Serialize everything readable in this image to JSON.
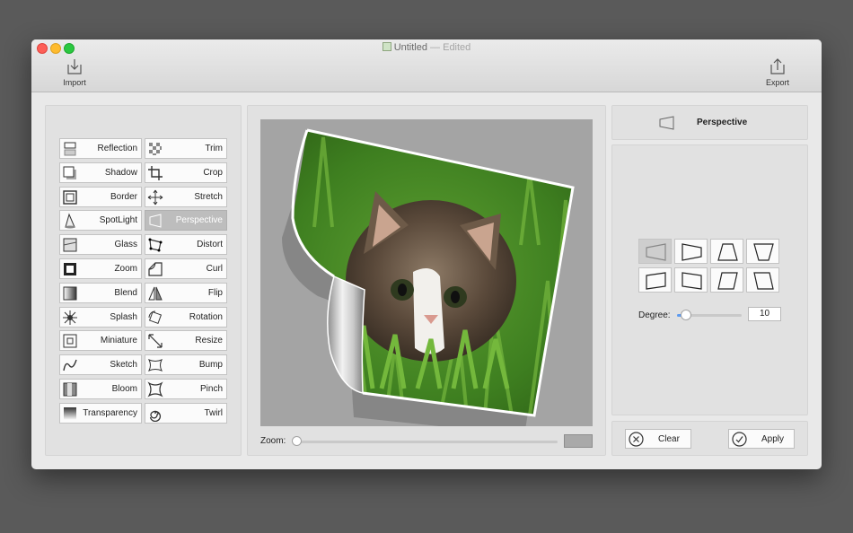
{
  "window": {
    "title": "Untitled",
    "edited": "— Edited",
    "import_label": "Import",
    "export_label": "Export"
  },
  "effects": [
    {
      "label": "Reflection",
      "icon": "reflection-icon"
    },
    {
      "label": "Trim",
      "icon": "checker-trim-icon"
    },
    {
      "label": "Shadow",
      "icon": "shadow-icon"
    },
    {
      "label": "Crop",
      "icon": "crop-icon"
    },
    {
      "label": "Border",
      "icon": "border-icon"
    },
    {
      "label": "Stretch",
      "icon": "stretch-arrows-icon"
    },
    {
      "label": "SpotLight",
      "icon": "spotlight-icon"
    },
    {
      "label": "Perspective",
      "icon": "perspective-icon",
      "selected": true
    },
    {
      "label": "Glass",
      "icon": "glass-icon"
    },
    {
      "label": "Distort",
      "icon": "distort-icon"
    },
    {
      "label": "Zoom",
      "icon": "zoom-blur-icon"
    },
    {
      "label": "Curl",
      "icon": "page-curl-icon"
    },
    {
      "label": "Blend",
      "icon": "blend-gradient-icon"
    },
    {
      "label": "Flip",
      "icon": "flip-icon"
    },
    {
      "label": "Splash",
      "icon": "splash-icon"
    },
    {
      "label": "Rotation",
      "icon": "rotation-icon"
    },
    {
      "label": "Miniature",
      "icon": "miniature-icon"
    },
    {
      "label": "Resize",
      "icon": "resize-arrow-icon"
    },
    {
      "label": "Sketch",
      "icon": "sketch-squiggle-icon"
    },
    {
      "label": "Bump",
      "icon": "bump-icon"
    },
    {
      "label": "Bloom",
      "icon": "bloom-icon"
    },
    {
      "label": "Pinch",
      "icon": "pinch-icon"
    },
    {
      "label": "Transparency",
      "icon": "transparency-gradient-icon"
    },
    {
      "label": "Twirl",
      "icon": "twirl-spiral-icon"
    }
  ],
  "canvas": {
    "zoom_label": "Zoom:",
    "zoom_fraction": 0.0,
    "swatch_color": "#a9a9a9"
  },
  "inspector": {
    "title": "Perspective",
    "degree_label": "Degree:",
    "degree_value": "10",
    "mode_icons": [
      "perspective-left-icon",
      "perspective-right-icon",
      "perspective-top-icon",
      "perspective-bottom-icon",
      "tilt-left-icon",
      "tilt-right-icon",
      "skew-right-icon",
      "skew-left-icon"
    ],
    "selected_mode": 0,
    "clear_label": "Clear",
    "apply_label": "Apply"
  },
  "colors": {
    "accent": "#5d9bf0",
    "selected_effect": "#bdbdbd",
    "background": "#5a5a5a"
  }
}
